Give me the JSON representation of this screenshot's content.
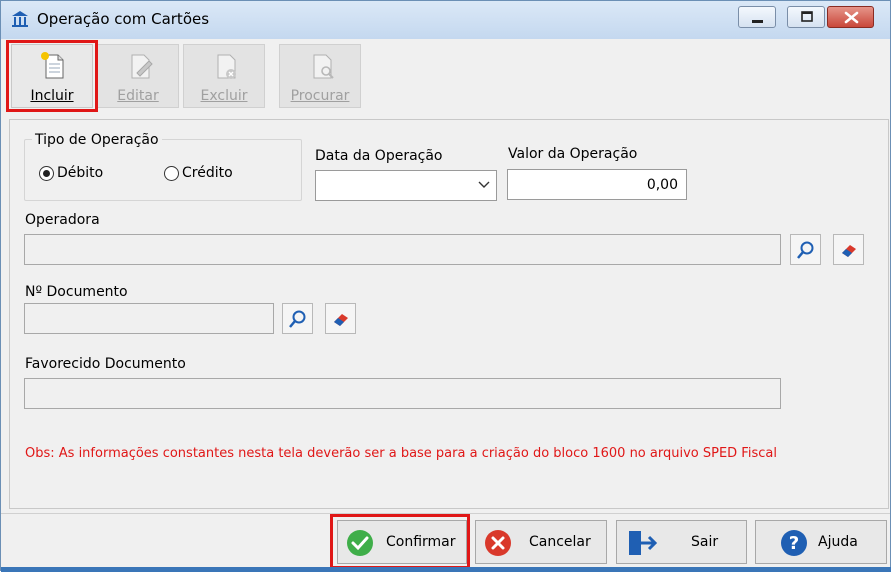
{
  "window": {
    "title": "Operação com Cartões"
  },
  "toolbar": {
    "buttons": [
      {
        "label": "Incluir",
        "enabled": true,
        "highlighted": true
      },
      {
        "label": "Editar",
        "enabled": false
      },
      {
        "label": "Excluir",
        "enabled": false
      },
      {
        "label": "Procurar",
        "enabled": false
      }
    ]
  },
  "form": {
    "tipo_operacao": {
      "title": "Tipo de Operação",
      "options": [
        {
          "label": "Débito",
          "selected": true
        },
        {
          "label": "Crédito",
          "selected": false
        }
      ]
    },
    "data_operacao": {
      "label": "Data da Operação",
      "value": ""
    },
    "valor_operacao": {
      "label": "Valor da Operação",
      "value": "0,00"
    },
    "operadora": {
      "label": "Operadora",
      "value": ""
    },
    "documento": {
      "label": "Nº Documento",
      "value": ""
    },
    "favorecido": {
      "label": "Favorecido Documento",
      "value": ""
    },
    "obs": "Obs: As informações constantes nesta tela deverão ser a base para a criação do bloco 1600 no arquivo SPED Fiscal"
  },
  "footer": {
    "buttons": [
      {
        "label": "Confirmar",
        "icon": "check-circle-icon",
        "highlighted": true
      },
      {
        "label": "Cancelar",
        "icon": "x-circle-icon"
      },
      {
        "label": "Sair",
        "icon": "exit-door-icon"
      },
      {
        "label": "Ajuda",
        "icon": "help-circle-icon"
      }
    ]
  },
  "colors": {
    "highlight": "#e01717",
    "obs_text": "#e01717",
    "confirm_icon": "#3fae49",
    "cancel_icon": "#d9392b",
    "help_icon": "#1f5fb3"
  }
}
